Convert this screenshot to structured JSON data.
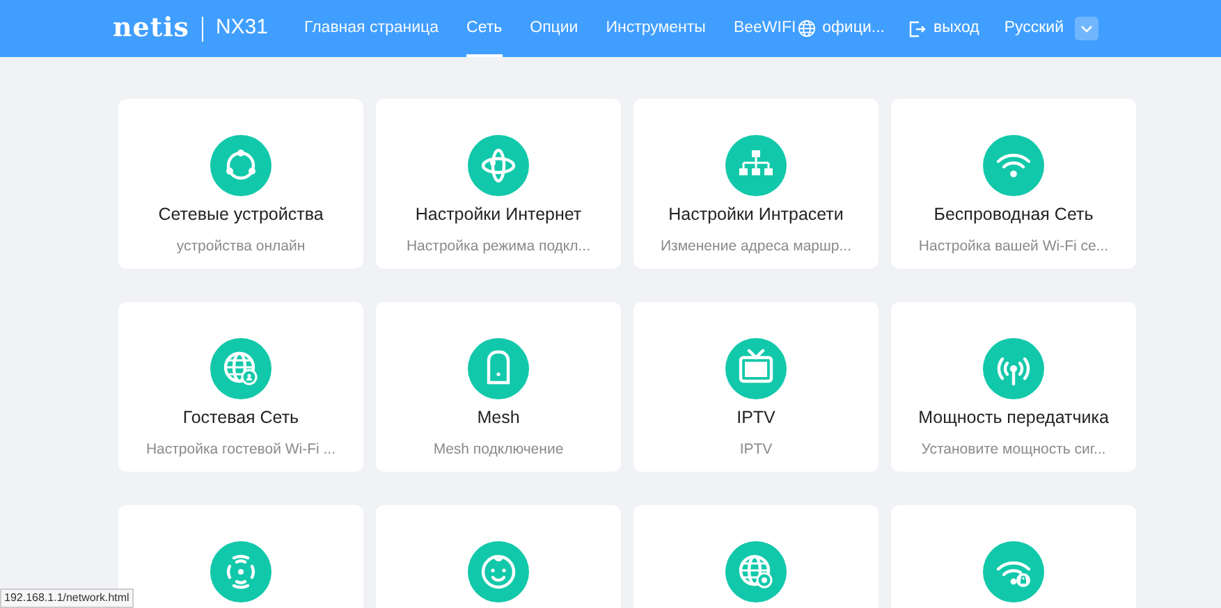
{
  "header": {
    "logo": "netis",
    "model": "NX31",
    "nav": [
      {
        "label": "Главная страница",
        "selected": false
      },
      {
        "label": "Сеть",
        "selected": true
      },
      {
        "label": "Опции",
        "selected": false
      },
      {
        "label": "Инструменты",
        "selected": false
      },
      {
        "label": "BeeWIFI",
        "selected": false
      }
    ],
    "official_link": "офици...",
    "logout": "выход",
    "language": "Русский"
  },
  "cards": [
    {
      "kind": "devices",
      "title": "Сетевые устройства",
      "subtitle": "устройства онлайн"
    },
    {
      "kind": "internet",
      "title": "Настройки Интернет",
      "subtitle": "Настройка режима подкл..."
    },
    {
      "kind": "lan",
      "title": "Настройки Интрасети",
      "subtitle": "Изменение адреса маршр..."
    },
    {
      "kind": "wifi",
      "title": "Беспроводная Сеть",
      "subtitle": "Настройка вашей Wi-Fi се..."
    },
    {
      "kind": "guest",
      "title": "Гостевая Сеть",
      "subtitle": "Настройка гостевой Wi-Fi ..."
    },
    {
      "kind": "mesh",
      "title": "Mesh",
      "subtitle": "Mesh подключение"
    },
    {
      "kind": "iptv",
      "title": "IPTV",
      "subtitle": "IPTV"
    },
    {
      "kind": "power",
      "title": "Мощность передатчика",
      "subtitle": "Установите мощность сиг..."
    },
    {
      "kind": "signal"
    },
    {
      "kind": "child"
    },
    {
      "kind": "portal"
    },
    {
      "kind": "wps"
    }
  ],
  "status_url": "192.168.1.1/network.html"
}
